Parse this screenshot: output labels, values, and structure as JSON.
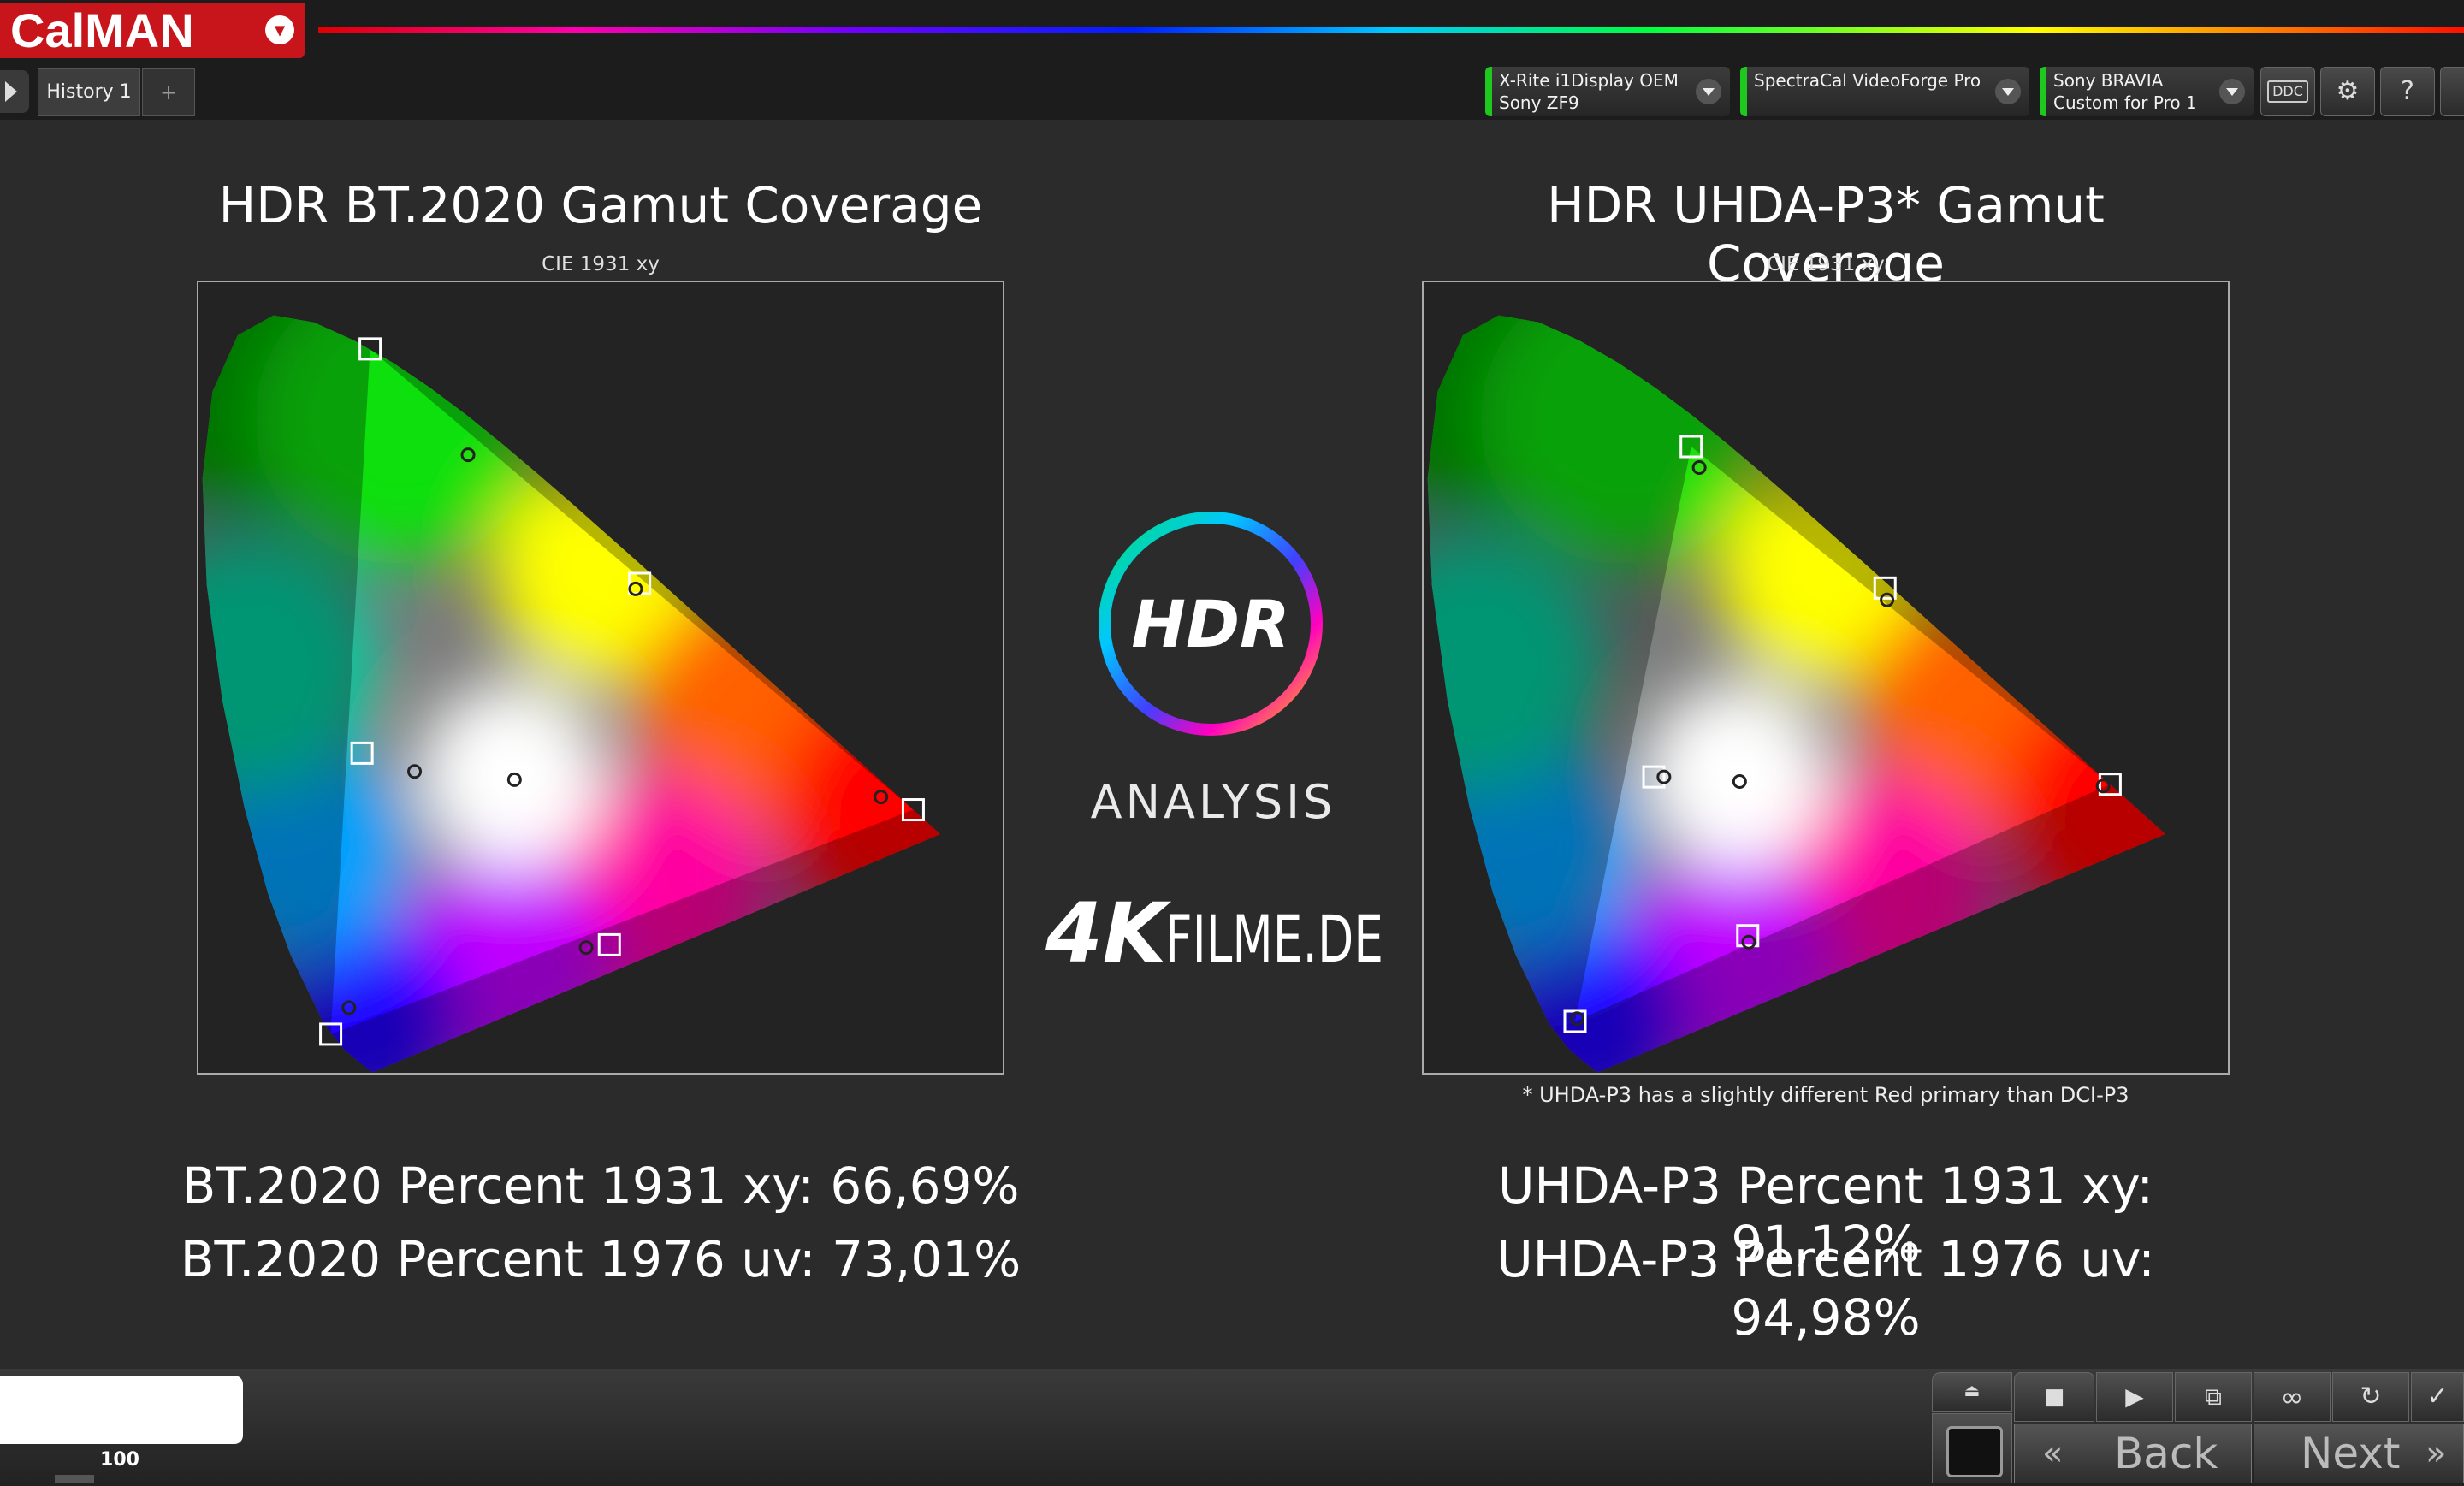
{
  "app": {
    "name": "CalMAN"
  },
  "tabs": {
    "history_label": "History 1",
    "add_label": "+"
  },
  "devices": [
    {
      "line1": "X-Rite i1Display OEM",
      "line2": "Sony ZF9"
    },
    {
      "line1": "SpectraCal VideoForge Pro",
      "line2": ""
    },
    {
      "line1": "Sony BRAVIA",
      "line2": "Custom for Pro 1"
    }
  ],
  "toolbar": {
    "ddc_label": "DDC",
    "help_label": "?"
  },
  "left_panel": {
    "title": "HDR BT.2020 Gamut Coverage",
    "subtitle": "CIE 1931 xy",
    "stat1": "BT.2020 Percent 1931 xy: 66,69%",
    "stat2": "BT.2020 Percent 1976 uv: 73,01%"
  },
  "right_panel": {
    "title": "HDR UHDA-P3* Gamut Coverage",
    "subtitle": "CIE 1931 xy",
    "footnote": "* UHDA-P3 has a slightly different Red primary than DCI-P3",
    "stat1": "UHDA-P3 Percent 1931 xy: 91,12%",
    "stat2": "UHDA-P3 Percent 1976 uv: 94,98%"
  },
  "center": {
    "logo_text": "HDR",
    "analysis": "ANALYSIS",
    "brand_big": "4K",
    "brand_small": "FILME.DE"
  },
  "bottom": {
    "swatch_value": "100",
    "back_label": "Back",
    "next_label": "Next"
  },
  "colors": {
    "accent": "#c8141b",
    "device_ok": "#1ec81e",
    "background": "#2b2b2b"
  },
  "chart_data": [
    {
      "type": "scatter",
      "title": "HDR BT.2020 Gamut Coverage",
      "subtitle": "CIE 1931 xy",
      "series": [
        {
          "name": "",
          "marker": "square",
          "points": [
            [
              0.17,
              0.797
            ],
            [
              0.708,
              0.292
            ],
            [
              0.131,
              0.046
            ],
            [
              0.437,
              0.54
            ],
            [
              0.162,
              0.354
            ],
            [
              0.407,
              0.144
            ],
            [
              0.3127,
              0.329
            ]
          ]
        },
        {
          "name": "",
          "marker": "circle",
          "points": [
            [
              0.267,
              0.681
            ],
            [
              0.676,
              0.306
            ],
            [
              0.149,
              0.075
            ],
            [
              0.433,
              0.534
            ],
            [
              0.214,
              0.334
            ],
            [
              0.384,
              0.141
            ],
            [
              0.313,
              0.325
            ]
          ]
        }
      ]
    },
    {
      "type": "scatter",
      "title": "HDR UHDA-P3* Gamut Coverage",
      "subtitle": "CIE 1931 xy",
      "series": [
        {
          "name": "",
          "marker": "square",
          "points": [
            [
              0.265,
              0.69
            ],
            [
              0.68,
              0.32
            ],
            [
              0.15,
              0.06
            ],
            [
              0.457,
              0.535
            ],
            [
              0.228,
              0.328
            ],
            [
              0.321,
              0.154
            ],
            [
              0.3127,
              0.329
            ]
          ]
        },
        {
          "name": "",
          "marker": "circle",
          "points": [
            [
              0.273,
              0.667
            ],
            [
              0.673,
              0.318
            ],
            [
              0.152,
              0.063
            ],
            [
              0.459,
              0.522
            ],
            [
              0.238,
              0.328
            ],
            [
              0.322,
              0.147
            ],
            [
              0.313,
              0.323
            ]
          ]
        }
      ]
    }
  ]
}
